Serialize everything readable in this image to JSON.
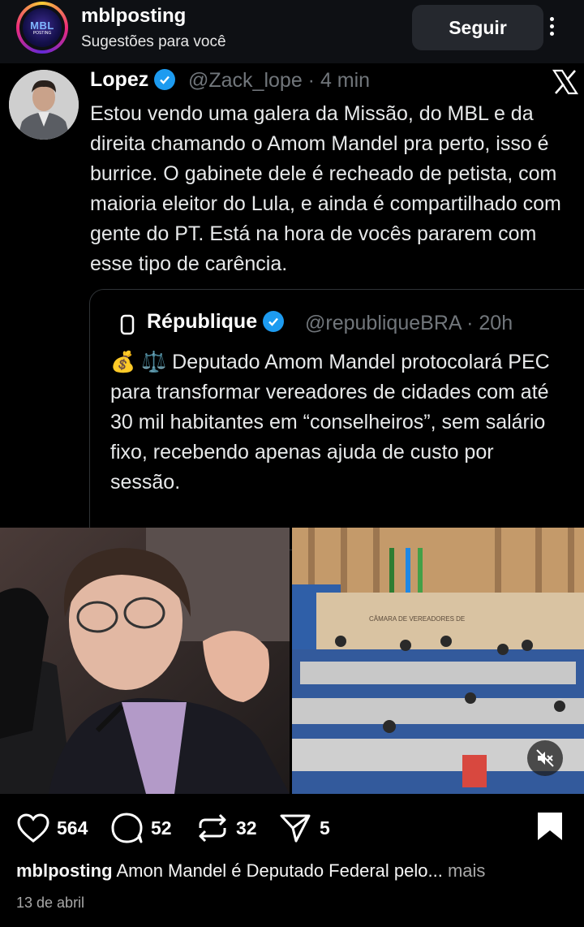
{
  "header": {
    "account_name": "mblposting",
    "subtitle": "Sugestões para você",
    "follow_label": "Seguir",
    "avatar_text_top": "MBL",
    "avatar_text_bottom": "POSTING"
  },
  "tweet": {
    "author_name": "Lopez",
    "handle_time": "@Zack_lope · 4 min",
    "body": "Estou vendo uma galera da Missão, do MBL e da direita chamando o Amom Mandel pra perto, isso é burrice. O gabinete dele é recheado de petista, com maioria eleitor do Lula, e ainda é compartilhado com gente do PT. Está na hora de vocês pararem com esse tipo de carência.",
    "quote": {
      "author_name": "République",
      "handle_time": "@republiqueBRA · 20h",
      "emoji": "💰 ⚖️",
      "body": "Deputado Amom Mandel protocolará PEC para transformar vereadores de cidades com até 30 mil habitantes em “conselheiros”, sem salário fixo, recebendo apenas ajuda de custo por sessão."
    },
    "images": {
      "right_chamber_label": "CÂMARA DE VEREADORES DE"
    }
  },
  "actions": {
    "likes": "564",
    "comments": "52",
    "reposts": "32",
    "shares": "5"
  },
  "caption": {
    "username": "mblposting",
    "text": "Amon Mandel é Deputado Federal pelo...",
    "more": "mais"
  },
  "date": "13 de abril",
  "colors": {
    "background": "#000000",
    "header_bg": "#0e1014",
    "verified_blue": "#1d9bf0",
    "secondary_text": "#71767b",
    "follow_button": "#25282e"
  },
  "icons": [
    "more-vertical-icon",
    "x-logo-icon",
    "verified-icon",
    "quote-logo-icon",
    "mute-icon",
    "heart-icon",
    "comment-icon",
    "repost-icon",
    "share-icon",
    "bookmark-icon"
  ]
}
